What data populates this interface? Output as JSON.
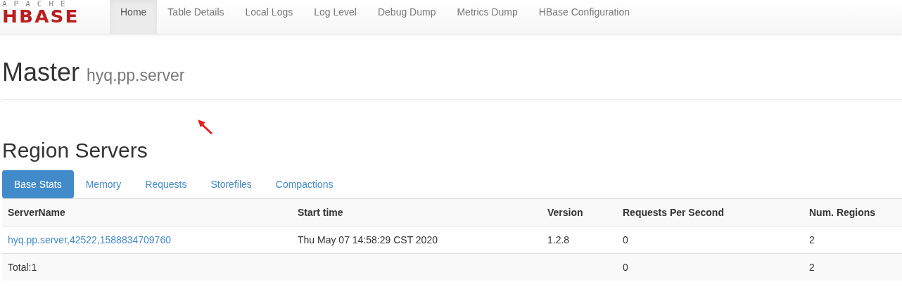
{
  "logo": {
    "top": "APACHE",
    "bottom": "HBASE"
  },
  "nav": [
    {
      "label": "Home",
      "selected": true
    },
    {
      "label": "Table Details",
      "selected": false
    },
    {
      "label": "Local Logs",
      "selected": false
    },
    {
      "label": "Log Level",
      "selected": false
    },
    {
      "label": "Debug Dump",
      "selected": false
    },
    {
      "label": "Metrics Dump",
      "selected": false
    },
    {
      "label": "HBase Configuration",
      "selected": false
    }
  ],
  "heading": {
    "title": "Master",
    "host": "hyq.pp.server"
  },
  "section_title": "Region Servers",
  "tabs": [
    {
      "label": "Base Stats",
      "selected": true
    },
    {
      "label": "Memory",
      "selected": false
    },
    {
      "label": "Requests",
      "selected": false
    },
    {
      "label": "Storefiles",
      "selected": false
    },
    {
      "label": "Compactions",
      "selected": false
    }
  ],
  "table": {
    "columns": [
      "ServerName",
      "Start time",
      "Version",
      "Requests Per Second",
      "Num. Regions"
    ],
    "rows": [
      {
        "kind": "link",
        "cells": [
          "hyq.pp.server,42522,1588834709760",
          "Thu May 07 14:58:29 CST 2020",
          "1.2.8",
          "0",
          "2"
        ]
      },
      {
        "kind": "total",
        "cells": [
          "Total:1",
          "",
          "",
          "0",
          "2"
        ]
      }
    ]
  }
}
